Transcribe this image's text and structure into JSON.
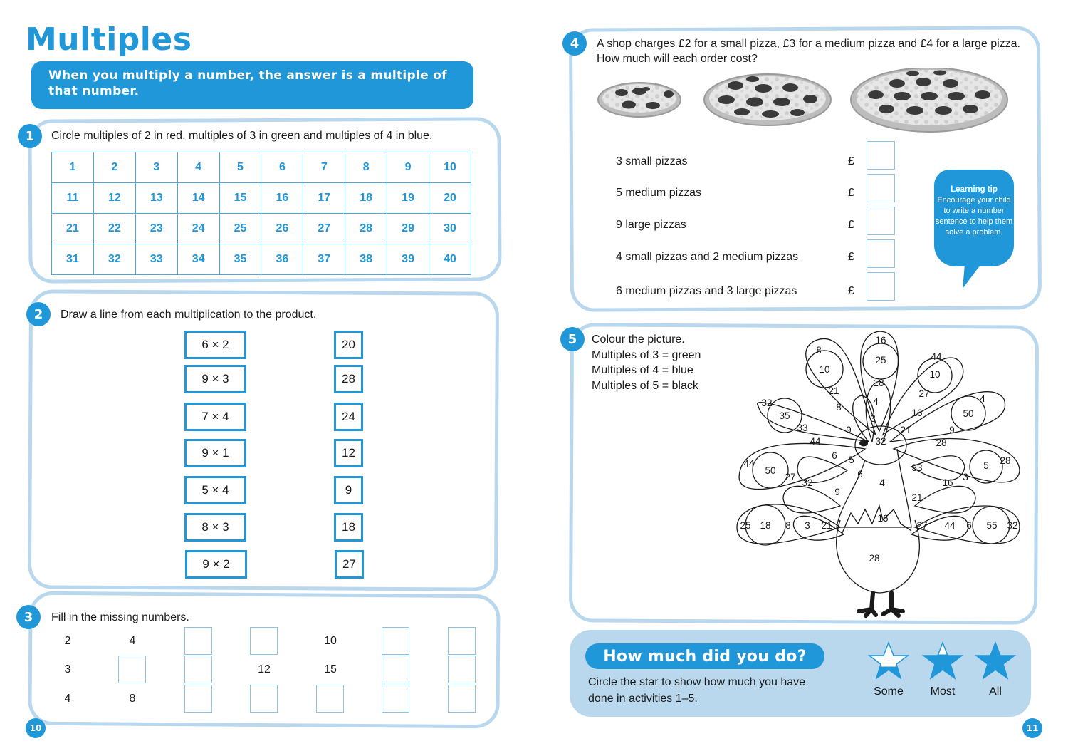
{
  "header": {
    "title": "Multiples",
    "intro": "When you multiply a number, the answer is a multiple of that number."
  },
  "activity1": {
    "number": "1",
    "instruction": "Circle multiples of 2 in red, multiples of 3 in green and multiples of 4 in blue.",
    "grid": [
      [
        "1",
        "2",
        "3",
        "4",
        "5",
        "6",
        "7",
        "8",
        "9",
        "10"
      ],
      [
        "11",
        "12",
        "13",
        "14",
        "15",
        "16",
        "17",
        "18",
        "19",
        "20"
      ],
      [
        "21",
        "22",
        "23",
        "24",
        "25",
        "26",
        "27",
        "28",
        "29",
        "30"
      ],
      [
        "31",
        "32",
        "33",
        "34",
        "35",
        "36",
        "37",
        "38",
        "39",
        "40"
      ]
    ]
  },
  "activity2": {
    "number": "2",
    "instruction": "Draw a line from each multiplication to the product.",
    "multiplications": [
      "6 × 2",
      "9 × 3",
      "7 × 4",
      "9 × 1",
      "5 × 4",
      "8 × 3",
      "9 × 2"
    ],
    "products": [
      "20",
      "28",
      "24",
      "12",
      "9",
      "18",
      "27"
    ]
  },
  "activity3": {
    "number": "3",
    "instruction": "Fill in the missing numbers.",
    "rows": [
      [
        "2",
        "4",
        "",
        "",
        "10",
        "",
        ""
      ],
      [
        "3",
        "",
        "",
        "12",
        "15",
        "",
        ""
      ],
      [
        "4",
        "8",
        "",
        "",
        "",
        "",
        ""
      ]
    ]
  },
  "activity4": {
    "number": "4",
    "instruction_line1": "A shop charges £2 for a small pizza, £3 for a medium pizza and £4 for a large pizza.",
    "instruction_line2": "How much will each order cost?",
    "pizzas": [
      "small-pizza",
      "medium-pizza",
      "large-pizza"
    ],
    "currency": "£",
    "orders": [
      {
        "label": "3 small pizzas",
        "answer": ""
      },
      {
        "label": "5 medium pizzas",
        "answer": ""
      },
      {
        "label": "9 large pizzas",
        "answer": ""
      },
      {
        "label": "4 small pizzas and 2 medium pizzas",
        "answer": ""
      },
      {
        "label": "6 medium pizzas and 3 large pizzas",
        "answer": ""
      }
    ],
    "tip": {
      "title": "Learning tip",
      "body": "Encourage your child to write a number sentence to help them solve a problem."
    }
  },
  "activity5": {
    "number": "5",
    "lines": [
      "Colour the picture.",
      "Multiples of 3 = green",
      "Multiples of 4 = blue",
      "Multiples of 5 = black"
    ],
    "peacock_numbers": [
      "16",
      "8",
      "25",
      "44",
      "10",
      "10",
      "18",
      "21",
      "27",
      "32",
      "4",
      "4",
      "35",
      "8",
      "3",
      "16",
      "50",
      "33",
      "9",
      "21",
      "9",
      "44",
      "32",
      "28",
      "6",
      "5",
      "6",
      "44",
      "50",
      "27",
      "32",
      "33",
      "5",
      "28",
      "9",
      "4",
      "16",
      "3",
      "21",
      "16",
      "25",
      "18",
      "8",
      "3",
      "21",
      "27",
      "44",
      "6",
      "55",
      "32",
      "28"
    ]
  },
  "assessment": {
    "title": "How much did you do?",
    "text": "Circle the star to show how much you have done in activities 1–5.",
    "stars": [
      {
        "label": "Some",
        "fill": 0.33
      },
      {
        "label": "Most",
        "fill": 0.67
      },
      {
        "label": "All",
        "fill": 1.0
      }
    ]
  },
  "page_numbers": {
    "left": "10",
    "right": "11"
  },
  "colors": {
    "accent": "#1f97d9",
    "panel_border": "#b9d8ee"
  }
}
